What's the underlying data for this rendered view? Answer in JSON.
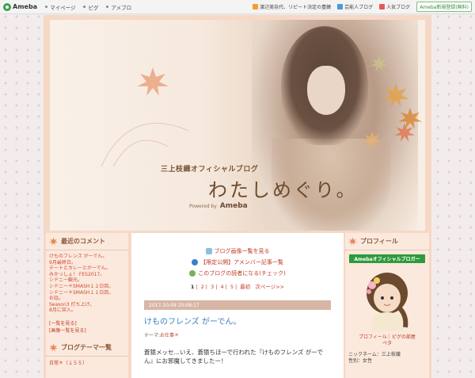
{
  "topbar": {
    "logo": "Ameba",
    "nav": [
      "マイページ",
      "ピグ",
      "アメブロ"
    ],
    "right_links": [
      "渡辺美奈代、リピート決定の豊饒",
      "芸能人ブログ",
      "人気ブログ"
    ],
    "signup": "Ameba新規登録(無料)"
  },
  "header": {
    "blog_title": "三上枝織オフィシャルブログ",
    "blog_subtitle": "わたしめぐり。",
    "powered_by": "Powered by",
    "powered_brand": "Ameba"
  },
  "left": {
    "recent_comments_title": "最近のコメント",
    "comments": [
      "けものフレンズ がーでん。",
      "9月最終日。",
      "デートとカレーとがーでん。",
      "みかっしょ！ FES2017。",
      "シドニー観光。",
      "シドニー＊SMASH１２日目。",
      "シドニー＊SMASH１１日目。",
      "お話。",
      "Season3 打ち上げ。",
      "8月に突入。"
    ],
    "links": [
      "[一覧を見る]",
      "[画像一覧を見る]"
    ],
    "theme_title": "ブログテーマ一覧",
    "theme_first": "日常＊（１５５）"
  },
  "center": {
    "top_links": [
      "ブログ画像一覧を見る",
      "【限定公開】アメンバー記事一覧",
      "このブログの読者になる(チェック)"
    ],
    "pager": {
      "pages": [
        "1",
        "2",
        "3",
        "4",
        "5"
      ],
      "last": "最初",
      "next": "次ページ>>"
    },
    "entry": {
      "date": "2017-10-09 20:08:17",
      "title": "けものフレンズ がーでん。",
      "theme_label": "テーマ:",
      "theme_value": "お仕事＊",
      "body": "蒼猿メッセ…いえ、蒼猿ちほーで行われた『けものフレンズ がーでん』にお邪魔してきましたー！"
    }
  },
  "right": {
    "profile_title": "プロフィール",
    "official_badge": "Amebaオフィシャルブロガー",
    "profile_link": "プロフィール｜ピグの部屋",
    "profile_link2": "ペタ",
    "nickname": "ニックネーム：三上枝織",
    "gender": "性別：女性"
  },
  "colors": {
    "accent_link": "#c03a25",
    "title_blue": "#3a7fc4",
    "official_green": "#2e9a3c",
    "frame_peach": "#f6d8c6"
  }
}
